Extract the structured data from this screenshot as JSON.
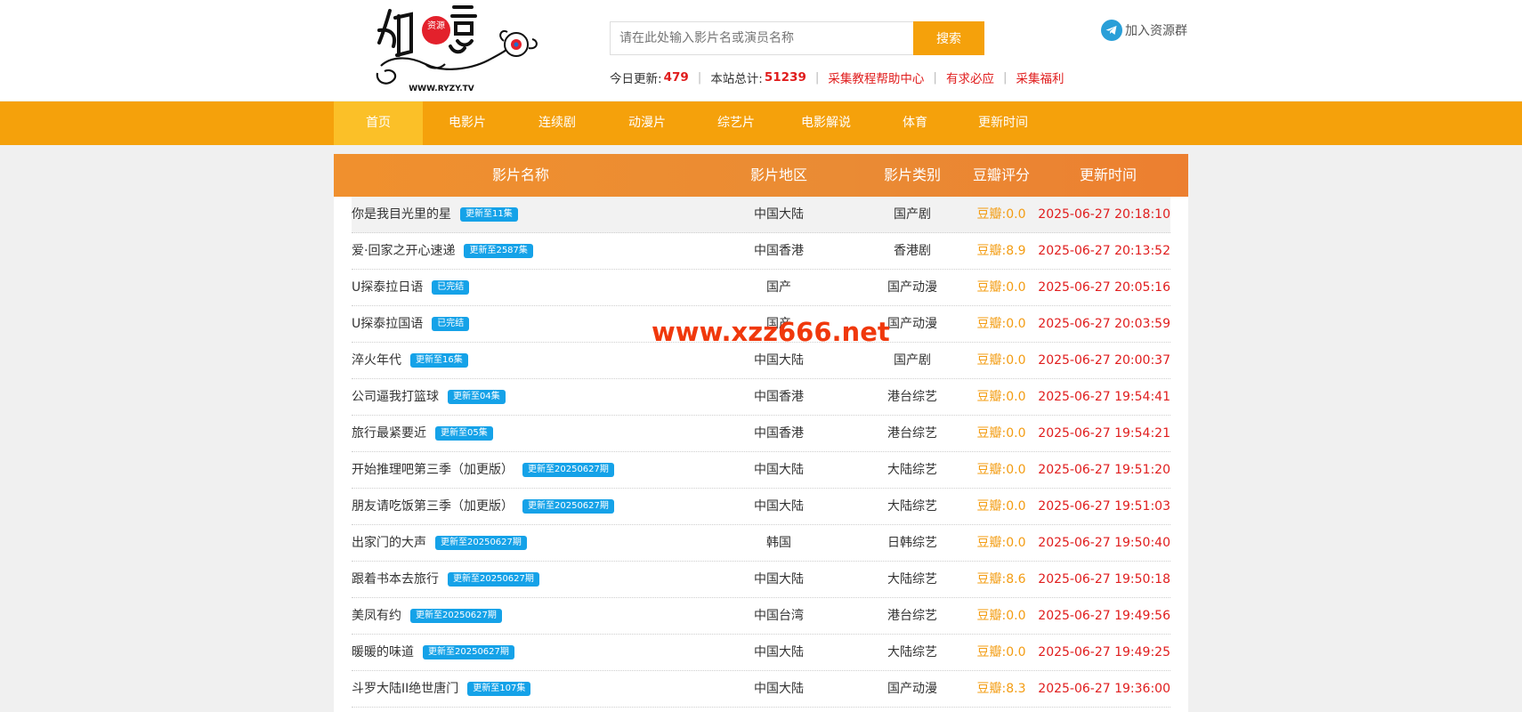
{
  "logo": {
    "main_chars": "如意",
    "seal_text": "资源",
    "url": "WWW.RYZY.TV"
  },
  "search": {
    "placeholder": "请在此处输入影片名或演员名称",
    "button_label": "搜索"
  },
  "join": {
    "label": "加入资源群",
    "icon": "telegram-icon"
  },
  "stats": {
    "today_label": "今日更新:",
    "today_value": "479",
    "total_label": "本站总计:",
    "total_value": "51239",
    "links": [
      "采集教程帮助中心",
      "有求必应",
      "采集福利"
    ]
  },
  "nav": [
    {
      "label": "首页",
      "active": true
    },
    {
      "label": "电影片",
      "active": false
    },
    {
      "label": "连续剧",
      "active": false
    },
    {
      "label": "动漫片",
      "active": false
    },
    {
      "label": "综艺片",
      "active": false
    },
    {
      "label": "电影解说",
      "active": false
    },
    {
      "label": "体育",
      "active": false
    },
    {
      "label": "更新时间",
      "active": false
    }
  ],
  "table": {
    "headers": [
      "影片名称",
      "影片地区",
      "影片类别",
      "豆瓣评分",
      "更新时间"
    ],
    "rows": [
      {
        "title": "你是我目光里的星",
        "badge": "更新至11集",
        "area": "中国大陆",
        "type": "国产剧",
        "score": "豆瓣:0.0",
        "time": "2025-06-27 20:18:10"
      },
      {
        "title": "爱·回家之开心速递",
        "badge": "更新至2587集",
        "area": "中国香港",
        "type": "香港剧",
        "score": "豆瓣:8.9",
        "time": "2025-06-27 20:13:52"
      },
      {
        "title": "U探泰拉日语",
        "badge": "已完结",
        "area": "国产",
        "type": "国产动漫",
        "score": "豆瓣:0.0",
        "time": "2025-06-27 20:05:16"
      },
      {
        "title": "U探泰拉国语",
        "badge": "已完结",
        "area": "国产",
        "type": "国产动漫",
        "score": "豆瓣:0.0",
        "time": "2025-06-27 20:03:59"
      },
      {
        "title": "淬火年代",
        "badge": "更新至16集",
        "area": "中国大陆",
        "type": "国产剧",
        "score": "豆瓣:0.0",
        "time": "2025-06-27 20:00:37"
      },
      {
        "title": "公司逼我打篮球",
        "badge": "更新至04集",
        "area": "中国香港",
        "type": "港台综艺",
        "score": "豆瓣:0.0",
        "time": "2025-06-27 19:54:41"
      },
      {
        "title": "旅行最紧要近",
        "badge": "更新至05集",
        "area": "中国香港",
        "type": "港台综艺",
        "score": "豆瓣:0.0",
        "time": "2025-06-27 19:54:21"
      },
      {
        "title": "开始推理吧第三季（加更版）",
        "badge": "更新至20250627期",
        "area": "中国大陆",
        "type": "大陆综艺",
        "score": "豆瓣:0.0",
        "time": "2025-06-27 19:51:20"
      },
      {
        "title": "朋友请吃饭第三季（加更版）",
        "badge": "更新至20250627期",
        "area": "中国大陆",
        "type": "大陆综艺",
        "score": "豆瓣:0.0",
        "time": "2025-06-27 19:51:03"
      },
      {
        "title": "出家门的大声",
        "badge": "更新至20250627期",
        "area": "韩国",
        "type": "日韩综艺",
        "score": "豆瓣:0.0",
        "time": "2025-06-27 19:50:40"
      },
      {
        "title": "跟着书本去旅行",
        "badge": "更新至20250627期",
        "area": "中国大陆",
        "type": "大陆综艺",
        "score": "豆瓣:8.6",
        "time": "2025-06-27 19:50:18"
      },
      {
        "title": "美凤有约",
        "badge": "更新至20250627期",
        "area": "中国台湾",
        "type": "港台综艺",
        "score": "豆瓣:0.0",
        "time": "2025-06-27 19:49:56"
      },
      {
        "title": "暖暖的味道",
        "badge": "更新至20250627期",
        "area": "中国大陆",
        "type": "大陆综艺",
        "score": "豆瓣:0.0",
        "time": "2025-06-27 19:49:25"
      },
      {
        "title": "斗罗大陆II绝世唐门",
        "badge": "更新至107集",
        "area": "中国大陆",
        "type": "国产动漫",
        "score": "豆瓣:8.3",
        "time": "2025-06-27 19:36:00"
      }
    ]
  },
  "watermark": "www.xzz666.net",
  "colors": {
    "accent": "#f5a10b",
    "nav_active": "#fbc028",
    "header_gradient": "#ea8b34",
    "badge": "#15a2e8",
    "red": "#e01d1d",
    "score": "#f39c12"
  }
}
